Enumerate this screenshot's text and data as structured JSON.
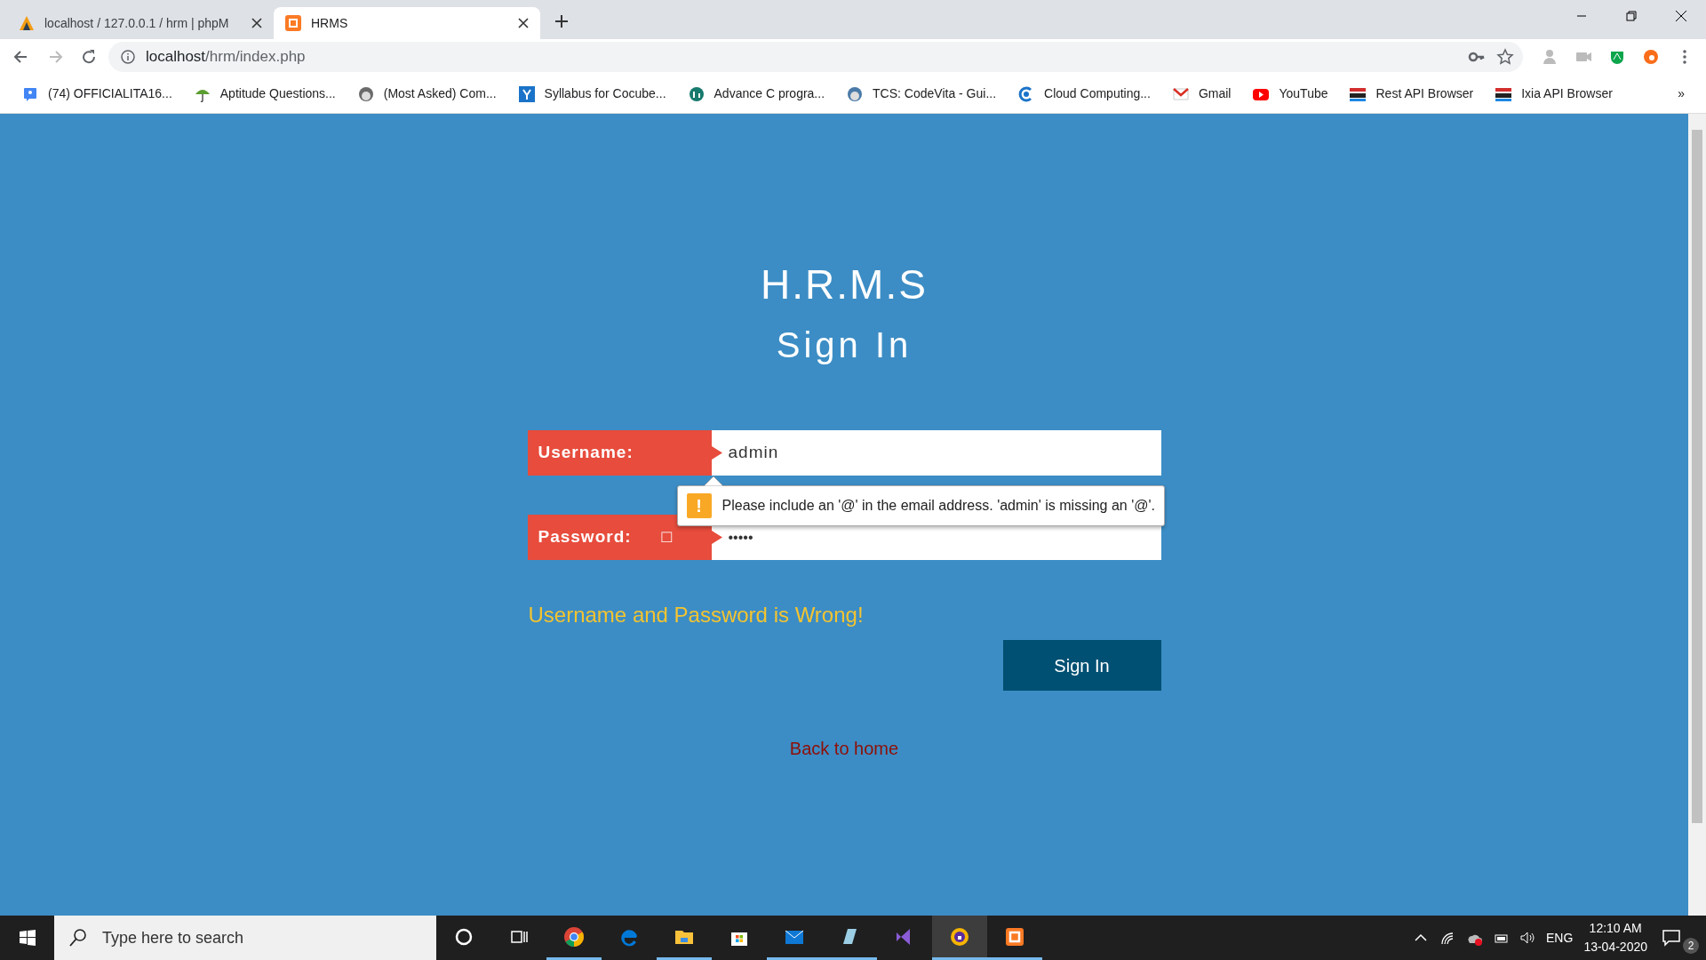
{
  "browser": {
    "tabs": [
      {
        "title": "localhost / 127.0.0.1 / hrm | phpM",
        "selected": false
      },
      {
        "title": "HRMS",
        "selected": true
      }
    ],
    "address": {
      "host": "localhost",
      "path": "/hrm/index.php"
    },
    "bookmarks": [
      {
        "label": "(74) OFFICIALITA16..."
      },
      {
        "label": "Aptitude Questions..."
      },
      {
        "label": "(Most Asked) Com..."
      },
      {
        "label": "Syllabus for Cocube..."
      },
      {
        "label": "Advance C progra..."
      },
      {
        "label": "TCS: CodeVita - Gui..."
      },
      {
        "label": "Cloud Computing..."
      },
      {
        "label": "Gmail"
      },
      {
        "label": "YouTube"
      },
      {
        "label": "Rest API Browser"
      },
      {
        "label": "Ixia API Browser"
      }
    ],
    "more": "»"
  },
  "page": {
    "title": "H.R.M.S",
    "subtitle": "Sign In",
    "fields": [
      {
        "label": "Username:",
        "value": "admin",
        "kind": "text"
      },
      {
        "label": "Password:",
        "glyph": "□",
        "value": "•••••",
        "kind": "password"
      }
    ],
    "tooltip": {
      "icon": "!",
      "text": "Please include an '@' in the email address. 'admin' is missing an '@'."
    },
    "error": "Username and Password is Wrong!",
    "button": "Sign In",
    "link": "Back to home"
  },
  "taskbar": {
    "search_placeholder": "Type here to search",
    "apps": [
      {
        "active": false,
        "running": false
      },
      {
        "active": false,
        "running": false
      },
      {
        "active": false,
        "running": true
      },
      {
        "active": false,
        "running": false
      },
      {
        "active": false,
        "running": true
      },
      {
        "active": false,
        "running": false
      },
      {
        "active": false,
        "running": true
      },
      {
        "active": false,
        "running": true
      },
      {
        "active": false,
        "running": false
      },
      {
        "active": true,
        "running": true
      },
      {
        "active": false,
        "running": true
      }
    ],
    "language": "ENG",
    "time": "12:10 AM",
    "date": "13-04-2020",
    "notifications": "2"
  }
}
